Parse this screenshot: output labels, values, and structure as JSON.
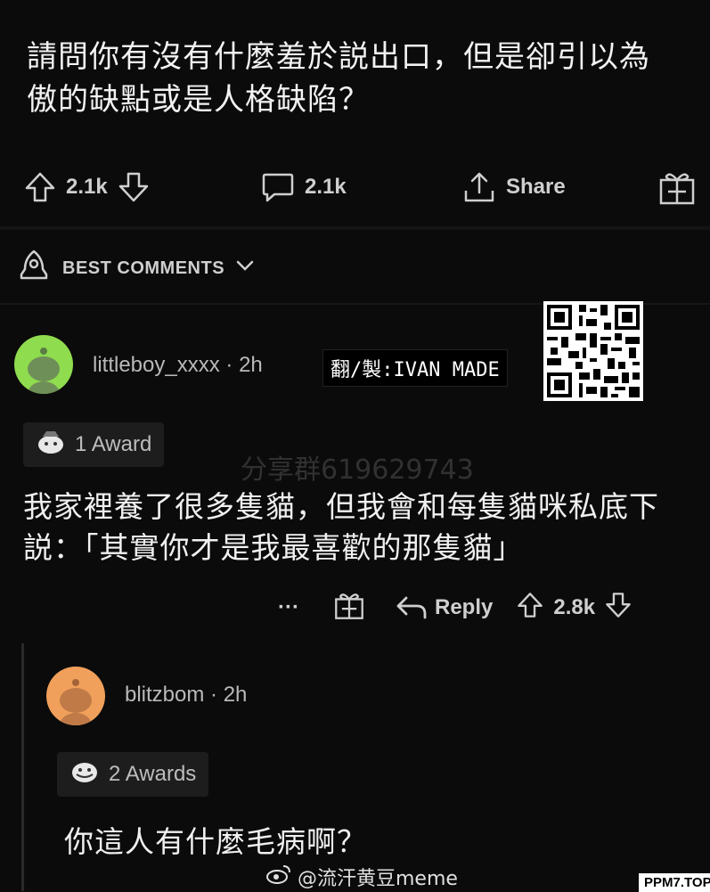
{
  "post": {
    "title": "請問你有沒有什麼羞於説出口，但是卻引以為傲的缺點或是人格缺陷？",
    "upvotes": "2.1k",
    "comments": "2.1k",
    "share_label": "Share"
  },
  "comments_header": {
    "label": "BEST COMMENTS"
  },
  "comment1": {
    "username": "littleboy_xxxx",
    "time": "· 2h",
    "award": "1 Award",
    "text": "我家裡養了很多隻貓，但我會和每隻貓咪私底下説：「其實你才是我最喜歡的那隻貓」",
    "more": "···",
    "reply_label": "Reply",
    "votes": "2.8k"
  },
  "comment2": {
    "username": "blitzbom",
    "time": "· 2h",
    "award": "2 Awards",
    "text": "你這人有什麼毛病啊？"
  },
  "overlays": {
    "translator_tag": "翻/製:IVAN MADE",
    "group_watermark": "分享群619629743",
    "weibo_handle": "@流汗黄豆meme",
    "site_credit": "PPM7.TOP"
  },
  "colors": {
    "avatar1": "#8fdc4e",
    "avatar2": "#f0a05a",
    "background": "#0b0b0b"
  }
}
